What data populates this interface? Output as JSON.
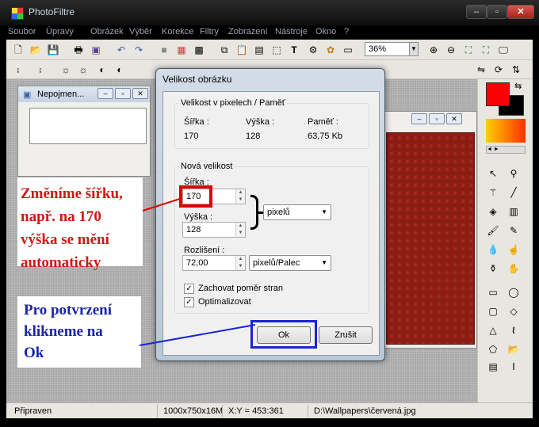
{
  "app": {
    "title": "PhotoFiltre",
    "icons": {
      "minimize": "minimize-icon",
      "maximize": "maximize-icon",
      "close": "close-icon"
    }
  },
  "menu": [
    "Soubor",
    "Úpravy",
    "Obrázek",
    "Výběr",
    "Korekce",
    "Filtry",
    "Zobrazení",
    "Nástroje",
    "Okno",
    "?"
  ],
  "toolbar": {
    "zoom": "36%"
  },
  "doc1": {
    "title": "Nepojmen..."
  },
  "dialog": {
    "title": "Velikost obrázku",
    "current": {
      "group": "Velikost v pixelech / Paměť",
      "width_label": "Šířka :",
      "width": "170",
      "height_label": "Výška :",
      "height": "128",
      "memory_label": "Paměť :",
      "memory": "63,75 Kb"
    },
    "new": {
      "group": "Nová velikost",
      "width_label": "Šířka :",
      "width": "170",
      "height_label": "Výška :",
      "height": "128",
      "unit": "pixelů",
      "res_label": "Rozlišení :",
      "resolution": "72,00",
      "res_unit": "pixelů/Palec"
    },
    "keep_ratio": "Zachovat poměr stran",
    "optimize": "Optimalizovat",
    "ok": "Ok",
    "cancel": "Zrušit"
  },
  "annotations": {
    "a1": [
      "Změníme šířku,",
      "např. na 170",
      "výška se mění",
      "automaticky"
    ],
    "a2": [
      "Pro potvrzení",
      "klikneme na",
      "Ok"
    ],
    "colors": {
      "red": "#cc1a14",
      "blue": "#1a24a6"
    }
  },
  "status": {
    "state": "Připraven",
    "size": "1000x750x16M",
    "coords": "X:Y = 453:361",
    "path": "D:\\Wallpapers\\červená.jpg"
  },
  "colors": {
    "fg": "#ff0000",
    "bg": "#000000"
  }
}
